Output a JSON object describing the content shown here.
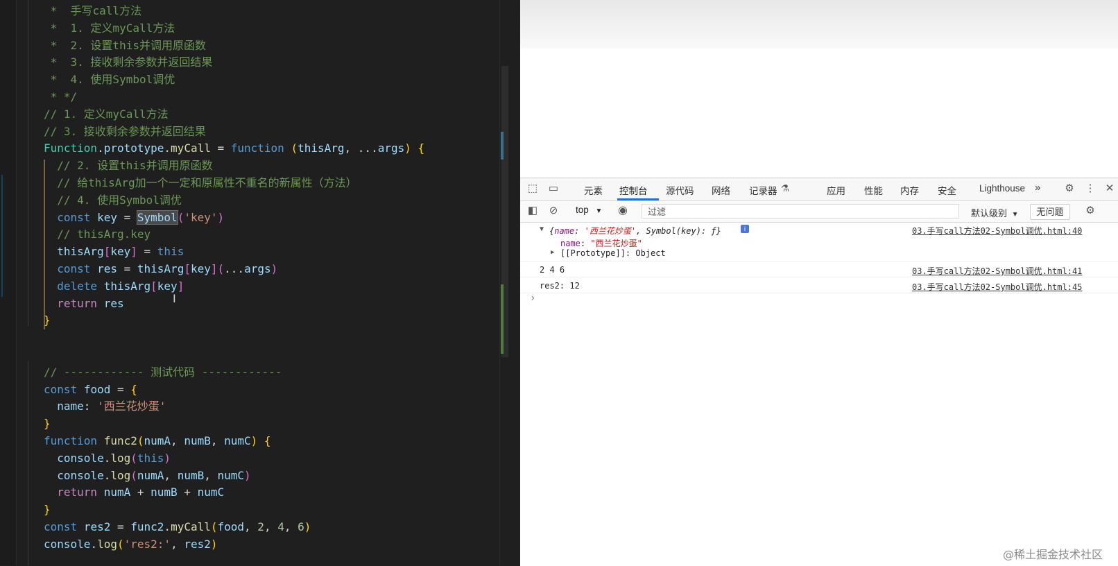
{
  "editor": {
    "lines": [
      [
        {
          "t": "c",
          "v": " *  手写call方法"
        }
      ],
      [
        {
          "t": "c",
          "v": " *  1. 定义myCall方法"
        }
      ],
      [
        {
          "t": "c",
          "v": " *  2. 设置this并调用原函数"
        }
      ],
      [
        {
          "t": "c",
          "v": " *  3. 接收剩余参数并返回结果"
        }
      ],
      [
        {
          "t": "c",
          "v": " *  4. 使用Symbol调优"
        }
      ],
      [
        {
          "t": "c",
          "v": " * */"
        }
      ],
      [
        {
          "t": "c",
          "v": "// 1. 定义myCall方法"
        }
      ],
      [
        {
          "t": "c",
          "v": "// 3. 接收剩余参数并返回结果"
        }
      ],
      [
        {
          "t": "t",
          "v": "Function"
        },
        {
          "t": "p",
          "v": "."
        },
        {
          "t": "v",
          "v": "prototype"
        },
        {
          "t": "p",
          "v": "."
        },
        {
          "t": "f",
          "v": "myCall"
        },
        {
          "t": "p",
          "v": " = "
        },
        {
          "t": "k",
          "v": "function"
        },
        {
          "t": "p",
          "v": " "
        },
        {
          "t": "y",
          "v": "("
        },
        {
          "t": "v",
          "v": "thisArg"
        },
        {
          "t": "p",
          "v": ", ..."
        },
        {
          "t": "v",
          "v": "args"
        },
        {
          "t": "y",
          "v": ")"
        },
        {
          "t": "p",
          "v": " "
        },
        {
          "t": "y",
          "v": "{"
        }
      ],
      [
        {
          "t": "c",
          "v": "  // 2. 设置this并调用原函数"
        }
      ],
      [
        {
          "t": "c",
          "v": "  // 给thisArg加一个一定和原属性不重名的新属性（方法）"
        }
      ],
      [
        {
          "t": "c",
          "v": "  // 4. 使用Symbol调优"
        }
      ],
      [
        {
          "t": "p",
          "v": "  "
        },
        {
          "t": "k",
          "v": "const"
        },
        {
          "t": "p",
          "v": " "
        },
        {
          "t": "v",
          "v": "key"
        },
        {
          "t": "p",
          "v": " = "
        },
        {
          "t": "hl",
          "v": "Symbol"
        },
        {
          "t": "pk",
          "v": "("
        },
        {
          "t": "s",
          "v": "'key'"
        },
        {
          "t": "pk",
          "v": ")"
        }
      ],
      [
        {
          "t": "c",
          "v": "  // thisArg.key"
        }
      ],
      [
        {
          "t": "p",
          "v": "  "
        },
        {
          "t": "v",
          "v": "thisArg"
        },
        {
          "t": "pk",
          "v": "["
        },
        {
          "t": "v",
          "v": "key"
        },
        {
          "t": "pk",
          "v": "]"
        },
        {
          "t": "p",
          "v": " = "
        },
        {
          "t": "k",
          "v": "this"
        }
      ],
      [
        {
          "t": "p",
          "v": "  "
        },
        {
          "t": "k",
          "v": "const"
        },
        {
          "t": "p",
          "v": " "
        },
        {
          "t": "v",
          "v": "res"
        },
        {
          "t": "p",
          "v": " = "
        },
        {
          "t": "v",
          "v": "thisArg"
        },
        {
          "t": "pk",
          "v": "["
        },
        {
          "t": "v",
          "v": "key"
        },
        {
          "t": "pk",
          "v": "]"
        },
        {
          "t": "pk",
          "v": "("
        },
        {
          "t": "p",
          "v": "..."
        },
        {
          "t": "v",
          "v": "args"
        },
        {
          "t": "pk",
          "v": ")"
        }
      ],
      [
        {
          "t": "p",
          "v": "  "
        },
        {
          "t": "k",
          "v": "delete"
        },
        {
          "t": "p",
          "v": " "
        },
        {
          "t": "v",
          "v": "thisArg"
        },
        {
          "t": "pk",
          "v": "["
        },
        {
          "t": "v",
          "v": "key"
        },
        {
          "t": "pk",
          "v": "]"
        }
      ],
      [
        {
          "t": "p",
          "v": "  "
        },
        {
          "t": "kw",
          "v": "return"
        },
        {
          "t": "p",
          "v": " "
        },
        {
          "t": "v",
          "v": "res"
        }
      ],
      [
        {
          "t": "y",
          "v": "}"
        }
      ],
      [],
      [],
      [
        {
          "t": "c",
          "v": "// ------------ 测试代码 ------------"
        }
      ],
      [
        {
          "t": "k",
          "v": "const"
        },
        {
          "t": "p",
          "v": " "
        },
        {
          "t": "v",
          "v": "food"
        },
        {
          "t": "p",
          "v": " = "
        },
        {
          "t": "y",
          "v": "{"
        }
      ],
      [
        {
          "t": "p",
          "v": "  "
        },
        {
          "t": "v",
          "v": "name"
        },
        {
          "t": "p",
          "v": ": "
        },
        {
          "t": "s",
          "v": "'西兰花炒蛋'"
        }
      ],
      [
        {
          "t": "y",
          "v": "}"
        }
      ],
      [
        {
          "t": "k",
          "v": "function"
        },
        {
          "t": "p",
          "v": " "
        },
        {
          "t": "f",
          "v": "func2"
        },
        {
          "t": "y",
          "v": "("
        },
        {
          "t": "v",
          "v": "numA"
        },
        {
          "t": "p",
          "v": ", "
        },
        {
          "t": "v",
          "v": "numB"
        },
        {
          "t": "p",
          "v": ", "
        },
        {
          "t": "v",
          "v": "numC"
        },
        {
          "t": "y",
          "v": ")"
        },
        {
          "t": "p",
          "v": " "
        },
        {
          "t": "y",
          "v": "{"
        }
      ],
      [
        {
          "t": "p",
          "v": "  "
        },
        {
          "t": "v",
          "v": "console"
        },
        {
          "t": "p",
          "v": "."
        },
        {
          "t": "f",
          "v": "log"
        },
        {
          "t": "pk",
          "v": "("
        },
        {
          "t": "k",
          "v": "this"
        },
        {
          "t": "pk",
          "v": ")"
        }
      ],
      [
        {
          "t": "p",
          "v": "  "
        },
        {
          "t": "v",
          "v": "console"
        },
        {
          "t": "p",
          "v": "."
        },
        {
          "t": "f",
          "v": "log"
        },
        {
          "t": "pk",
          "v": "("
        },
        {
          "t": "v",
          "v": "numA"
        },
        {
          "t": "p",
          "v": ", "
        },
        {
          "t": "v",
          "v": "numB"
        },
        {
          "t": "p",
          "v": ", "
        },
        {
          "t": "v",
          "v": "numC"
        },
        {
          "t": "pk",
          "v": ")"
        }
      ],
      [
        {
          "t": "p",
          "v": "  "
        },
        {
          "t": "kw",
          "v": "return"
        },
        {
          "t": "p",
          "v": " "
        },
        {
          "t": "v",
          "v": "numA"
        },
        {
          "t": "p",
          "v": " + "
        },
        {
          "t": "v",
          "v": "numB"
        },
        {
          "t": "p",
          "v": " + "
        },
        {
          "t": "v",
          "v": "numC"
        }
      ],
      [
        {
          "t": "y",
          "v": "}"
        }
      ],
      [
        {
          "t": "k",
          "v": "const"
        },
        {
          "t": "p",
          "v": " "
        },
        {
          "t": "v",
          "v": "res2"
        },
        {
          "t": "p",
          "v": " = "
        },
        {
          "t": "v",
          "v": "func2"
        },
        {
          "t": "p",
          "v": "."
        },
        {
          "t": "f",
          "v": "myCall"
        },
        {
          "t": "y",
          "v": "("
        },
        {
          "t": "v",
          "v": "food"
        },
        {
          "t": "p",
          "v": ", "
        },
        {
          "t": "n",
          "v": "2"
        },
        {
          "t": "p",
          "v": ", "
        },
        {
          "t": "n",
          "v": "4"
        },
        {
          "t": "p",
          "v": ", "
        },
        {
          "t": "n",
          "v": "6"
        },
        {
          "t": "y",
          "v": ")"
        }
      ],
      [
        {
          "t": "v",
          "v": "console"
        },
        {
          "t": "p",
          "v": "."
        },
        {
          "t": "f",
          "v": "log"
        },
        {
          "t": "y",
          "v": "("
        },
        {
          "t": "s",
          "v": "'res2:'"
        },
        {
          "t": "p",
          "v": ", "
        },
        {
          "t": "v",
          "v": "res2"
        },
        {
          "t": "y",
          "v": ")"
        }
      ]
    ]
  },
  "devtools": {
    "tabs": [
      "元素",
      "控制台",
      "源代码",
      "网络",
      "记录器",
      "应用",
      "性能",
      "内存",
      "安全",
      "Lighthouse"
    ],
    "active_tab": "控制台",
    "more_tabs": "»",
    "context": "top",
    "filter_placeholder": "过滤",
    "levels": "默认级别",
    "issues_button": "无问题",
    "console": {
      "obj_summary_open": "{",
      "obj_key1": "name",
      "obj_val1": "'西兰花炒蛋'",
      "obj_rest": ", Symbol(key): ƒ}",
      "prop_name_key": "name",
      "prop_name_val": "\"西兰花炒蛋\"",
      "prototype": "[[Prototype]]: Object",
      "info_badge": "i",
      "msg2": "2 4 6",
      "msg3": "res2: 12",
      "src1": "03.手写call方法02-Symbol调优.html:40",
      "src2": "03.手写call方法02-Symbol调优.html:41",
      "src3": "03.手写call方法02-Symbol调优.html:45",
      "prompt": "›"
    }
  },
  "watermark": "@稀土掘金技术社区"
}
